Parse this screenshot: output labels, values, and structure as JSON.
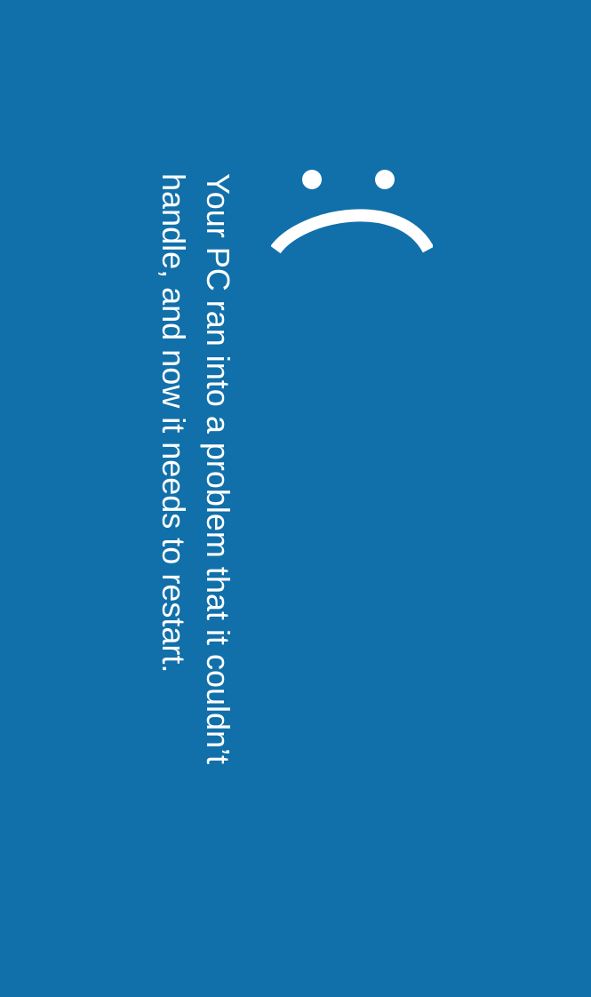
{
  "screen": {
    "background_color": "#1170aa",
    "text_color": "#ffffff",
    "icon": "sad-face-icon",
    "message_lines": [
      "Your PC ran into a problem that it couldn’t",
      "handle, and now it needs to restart."
    ]
  }
}
